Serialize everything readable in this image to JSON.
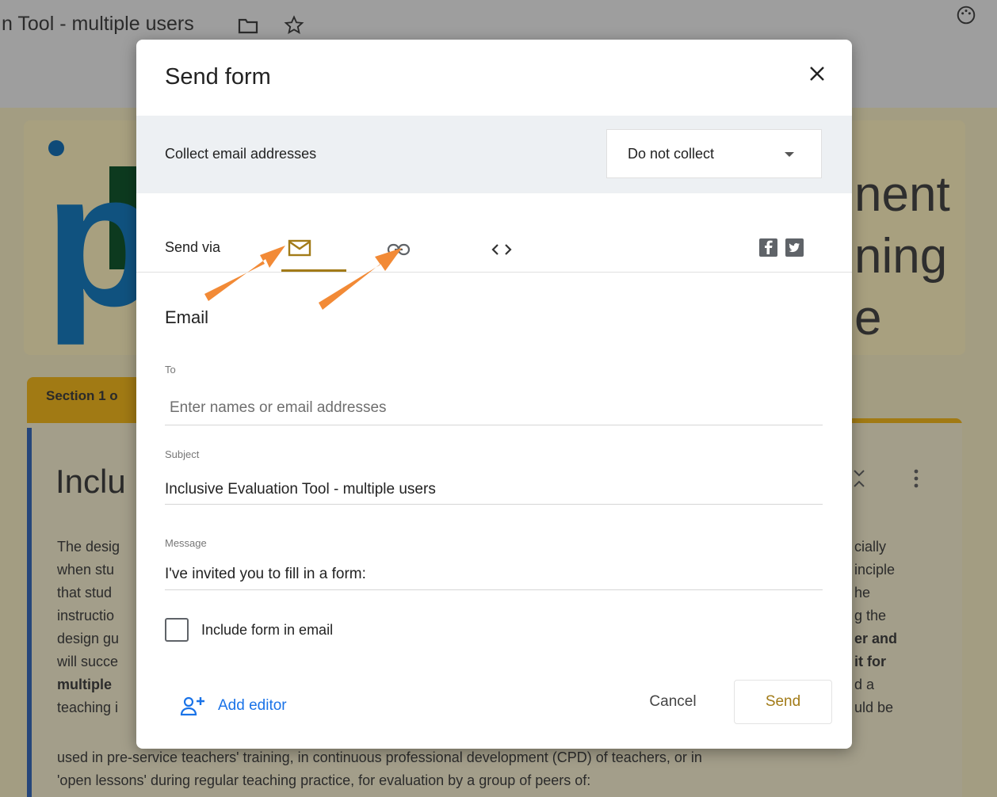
{
  "app": {
    "doc_title": "n Tool - multiple users",
    "folder_icon": "folder-icon",
    "star_icon": "star-icon",
    "palette_icon": "palette-icon"
  },
  "background": {
    "header_right_lines": [
      "nent",
      "ning",
      "e"
    ],
    "section_label": "Section 1 o",
    "content_title": "Inclu",
    "para_left": [
      "The desig",
      "when stu",
      "that stud",
      "instructio",
      "design gu",
      "will succe",
      "multiple",
      "teaching i"
    ],
    "para_right": [
      "cially",
      "inciple",
      "he",
      "g the",
      "er and",
      "it for",
      "d a",
      "uld be"
    ],
    "para_bottom": [
      "used in pre-service teachers' training, in continuous professional development (CPD) of teachers, or in",
      "'open lessons' during regular teaching practice, for evaluation by a group of peers of:"
    ],
    "colors": {
      "page": "#a39d82",
      "section_accent": "#a17a14",
      "logo_blue": "#10527f",
      "logo_green": "#0d3a1f"
    }
  },
  "dialog": {
    "title": "Send form",
    "close_icon": "close-icon",
    "collect": {
      "label": "Collect email addresses",
      "selected": "Do not collect"
    },
    "send_via": {
      "label": "Send via",
      "tabs": [
        {
          "name": "email",
          "icon": "mail-icon",
          "active": true
        },
        {
          "name": "link",
          "icon": "link-icon",
          "active": false
        },
        {
          "name": "embed",
          "icon": "code-icon",
          "active": false
        }
      ],
      "social_icons": [
        "facebook-icon",
        "twitter-icon"
      ]
    },
    "email": {
      "heading": "Email",
      "to_label": "To",
      "to_placeholder": "Enter names or email addresses",
      "subject_label": "Subject",
      "subject_value": "Inclusive Evaluation Tool - multiple users",
      "message_label": "Message",
      "message_value": "I've invited you to fill in a form:",
      "include_label": "Include form in email",
      "include_checked": false
    },
    "footer": {
      "add_editor": "Add editor",
      "cancel": "Cancel",
      "send": "Send"
    },
    "colors": {
      "accent": "#a27b18",
      "link_blue": "#1a73e8",
      "annotation_arrow": "#f28a36"
    }
  }
}
